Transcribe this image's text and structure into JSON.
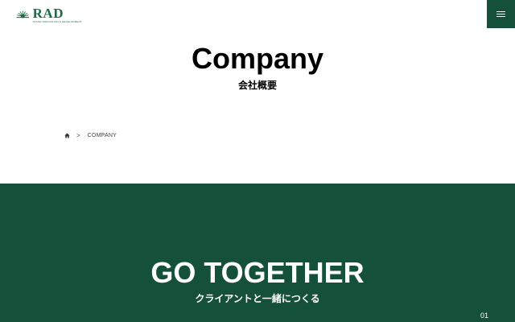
{
  "header": {
    "logo": {
      "word": "RAD",
      "tagline": "STAND INNOVATION & DEVELOPMENT",
      "icon": "sunburst-logo-icon"
    },
    "menu_icon": "hamburger-icon"
  },
  "page": {
    "title": "Company",
    "subtitle": "会社概要"
  },
  "breadcrumb": {
    "home_icon": "home-icon",
    "separator": ">",
    "current": "COMPANY"
  },
  "hero": {
    "title": "GO TOGETHER",
    "subtitle": "クライアントと一緒につくる",
    "index": "01"
  },
  "colors": {
    "brand_green": "#15503a",
    "logo_green": "#1c6b45",
    "background": "#ffffff"
  }
}
